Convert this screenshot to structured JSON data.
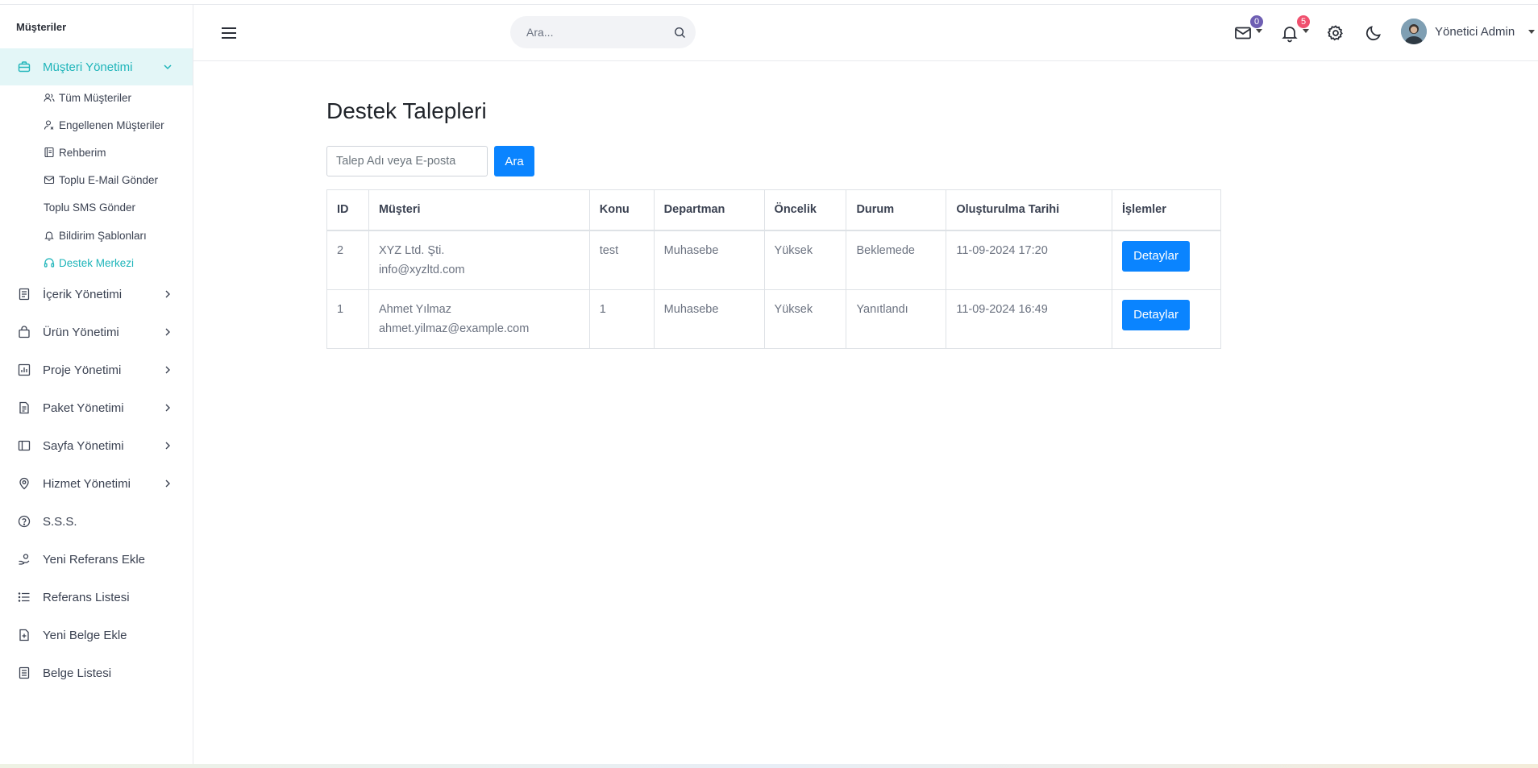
{
  "sidebar": {
    "title": "Müşteriler",
    "active_group": {
      "label": "Müşteri Yönetimi"
    },
    "sub_items": [
      {
        "label": "Tüm Müşteriler"
      },
      {
        "label": "Engellenen Müşteriler"
      },
      {
        "label": "Rehberim"
      },
      {
        "label": "Toplu E-Mail Gönder"
      },
      {
        "label": "Toplu SMS Gönder"
      },
      {
        "label": "Bildirim Şablonları"
      },
      {
        "label": "Destek Merkezi"
      }
    ],
    "items": [
      {
        "label": "İçerik Yönetimi"
      },
      {
        "label": "Ürün Yönetimi"
      },
      {
        "label": "Proje Yönetimi"
      },
      {
        "label": "Paket Yönetimi"
      },
      {
        "label": "Sayfa Yönetimi"
      },
      {
        "label": "Hizmet Yönetimi"
      },
      {
        "label": "S.S.S."
      },
      {
        "label": "Yeni Referans Ekle"
      },
      {
        "label": "Referans Listesi"
      },
      {
        "label": "Yeni Belge Ekle"
      },
      {
        "label": "Belge Listesi"
      }
    ]
  },
  "header": {
    "search_placeholder": "Ara...",
    "mail_badge": "0",
    "notif_badge": "5",
    "user_name": "Yönetici Admin",
    "colors": {
      "mail_badge": "#6f5fb3",
      "notif_badge": "#f0506e"
    }
  },
  "main": {
    "title": "Destek Talepleri",
    "search_placeholder": "Talep Adı veya E-posta",
    "search_button": "Ara",
    "table": {
      "headers": [
        "ID",
        "Müşteri",
        "Konu",
        "Departman",
        "Öncelik",
        "Durum",
        "Oluşturulma Tarihi",
        "İşlemler"
      ],
      "rows": [
        {
          "id": "2",
          "customer_name": "XYZ Ltd. Şti.",
          "customer_email": "info@xyzltd.com",
          "subject": "test",
          "department": "Muhasebe",
          "priority": "Yüksek",
          "status": "Beklemede",
          "created": "11-09-2024 17:20",
          "action": "Detaylar"
        },
        {
          "id": "1",
          "customer_name": "Ahmet Yılmaz",
          "customer_email": "ahmet.yilmaz@example.com",
          "subject": "1",
          "department": "Muhasebe",
          "priority": "Yüksek",
          "status": "Yanıtlandı",
          "created": "11-09-2024 16:49",
          "action": "Detaylar"
        }
      ]
    }
  },
  "colors": {
    "accent": "#1fb5ba",
    "primary_button": "#0a84ff"
  }
}
